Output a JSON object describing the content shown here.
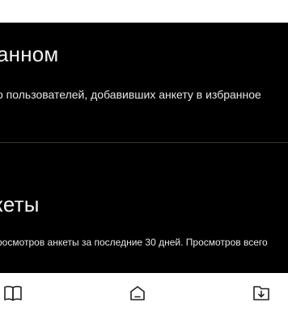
{
  "sections": [
    {
      "heading": "анном",
      "description": "о пользователей, добавивших анкету в избранное"
    },
    {
      "heading": "кеты",
      "description": "росмотров анкеты за последние 30 дней. Просмотров всего"
    }
  ],
  "nav": {
    "icons": [
      "book-icon",
      "home-icon",
      "download-icon"
    ]
  },
  "colors": {
    "content_bg": "#000000",
    "text": "#f2f2f2",
    "divider": "#2f3a27",
    "nav_bg": "#ffffff",
    "icon": "#222222"
  }
}
